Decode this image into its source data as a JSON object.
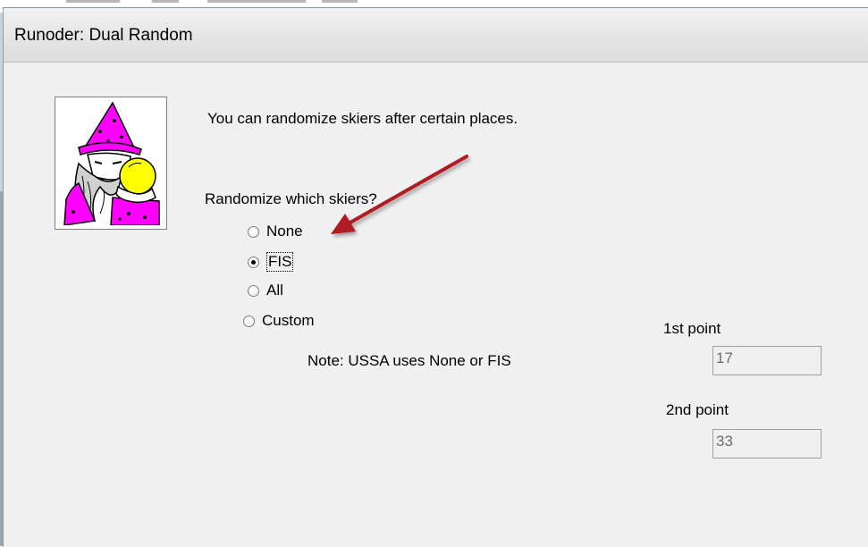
{
  "dialog": {
    "title": "Runoder: Dual Random",
    "intro_text": "You can randomize skiers after certain places.",
    "question": "Randomize which skiers?",
    "options": [
      {
        "label": "None",
        "checked": false
      },
      {
        "label": "FIS",
        "checked": true
      },
      {
        "label": "All",
        "checked": false
      },
      {
        "label": "Custom",
        "checked": false
      }
    ],
    "note": "Note: USSA uses None or FIS",
    "first_point": {
      "label": "1st point",
      "value": "17"
    },
    "second_point": {
      "label": "2nd point",
      "value": "33"
    }
  },
  "annotation": {
    "arrow_color": "#b01e23",
    "pointing_to": "FIS"
  },
  "icons": {
    "wizard_image": "wizard-icon"
  }
}
